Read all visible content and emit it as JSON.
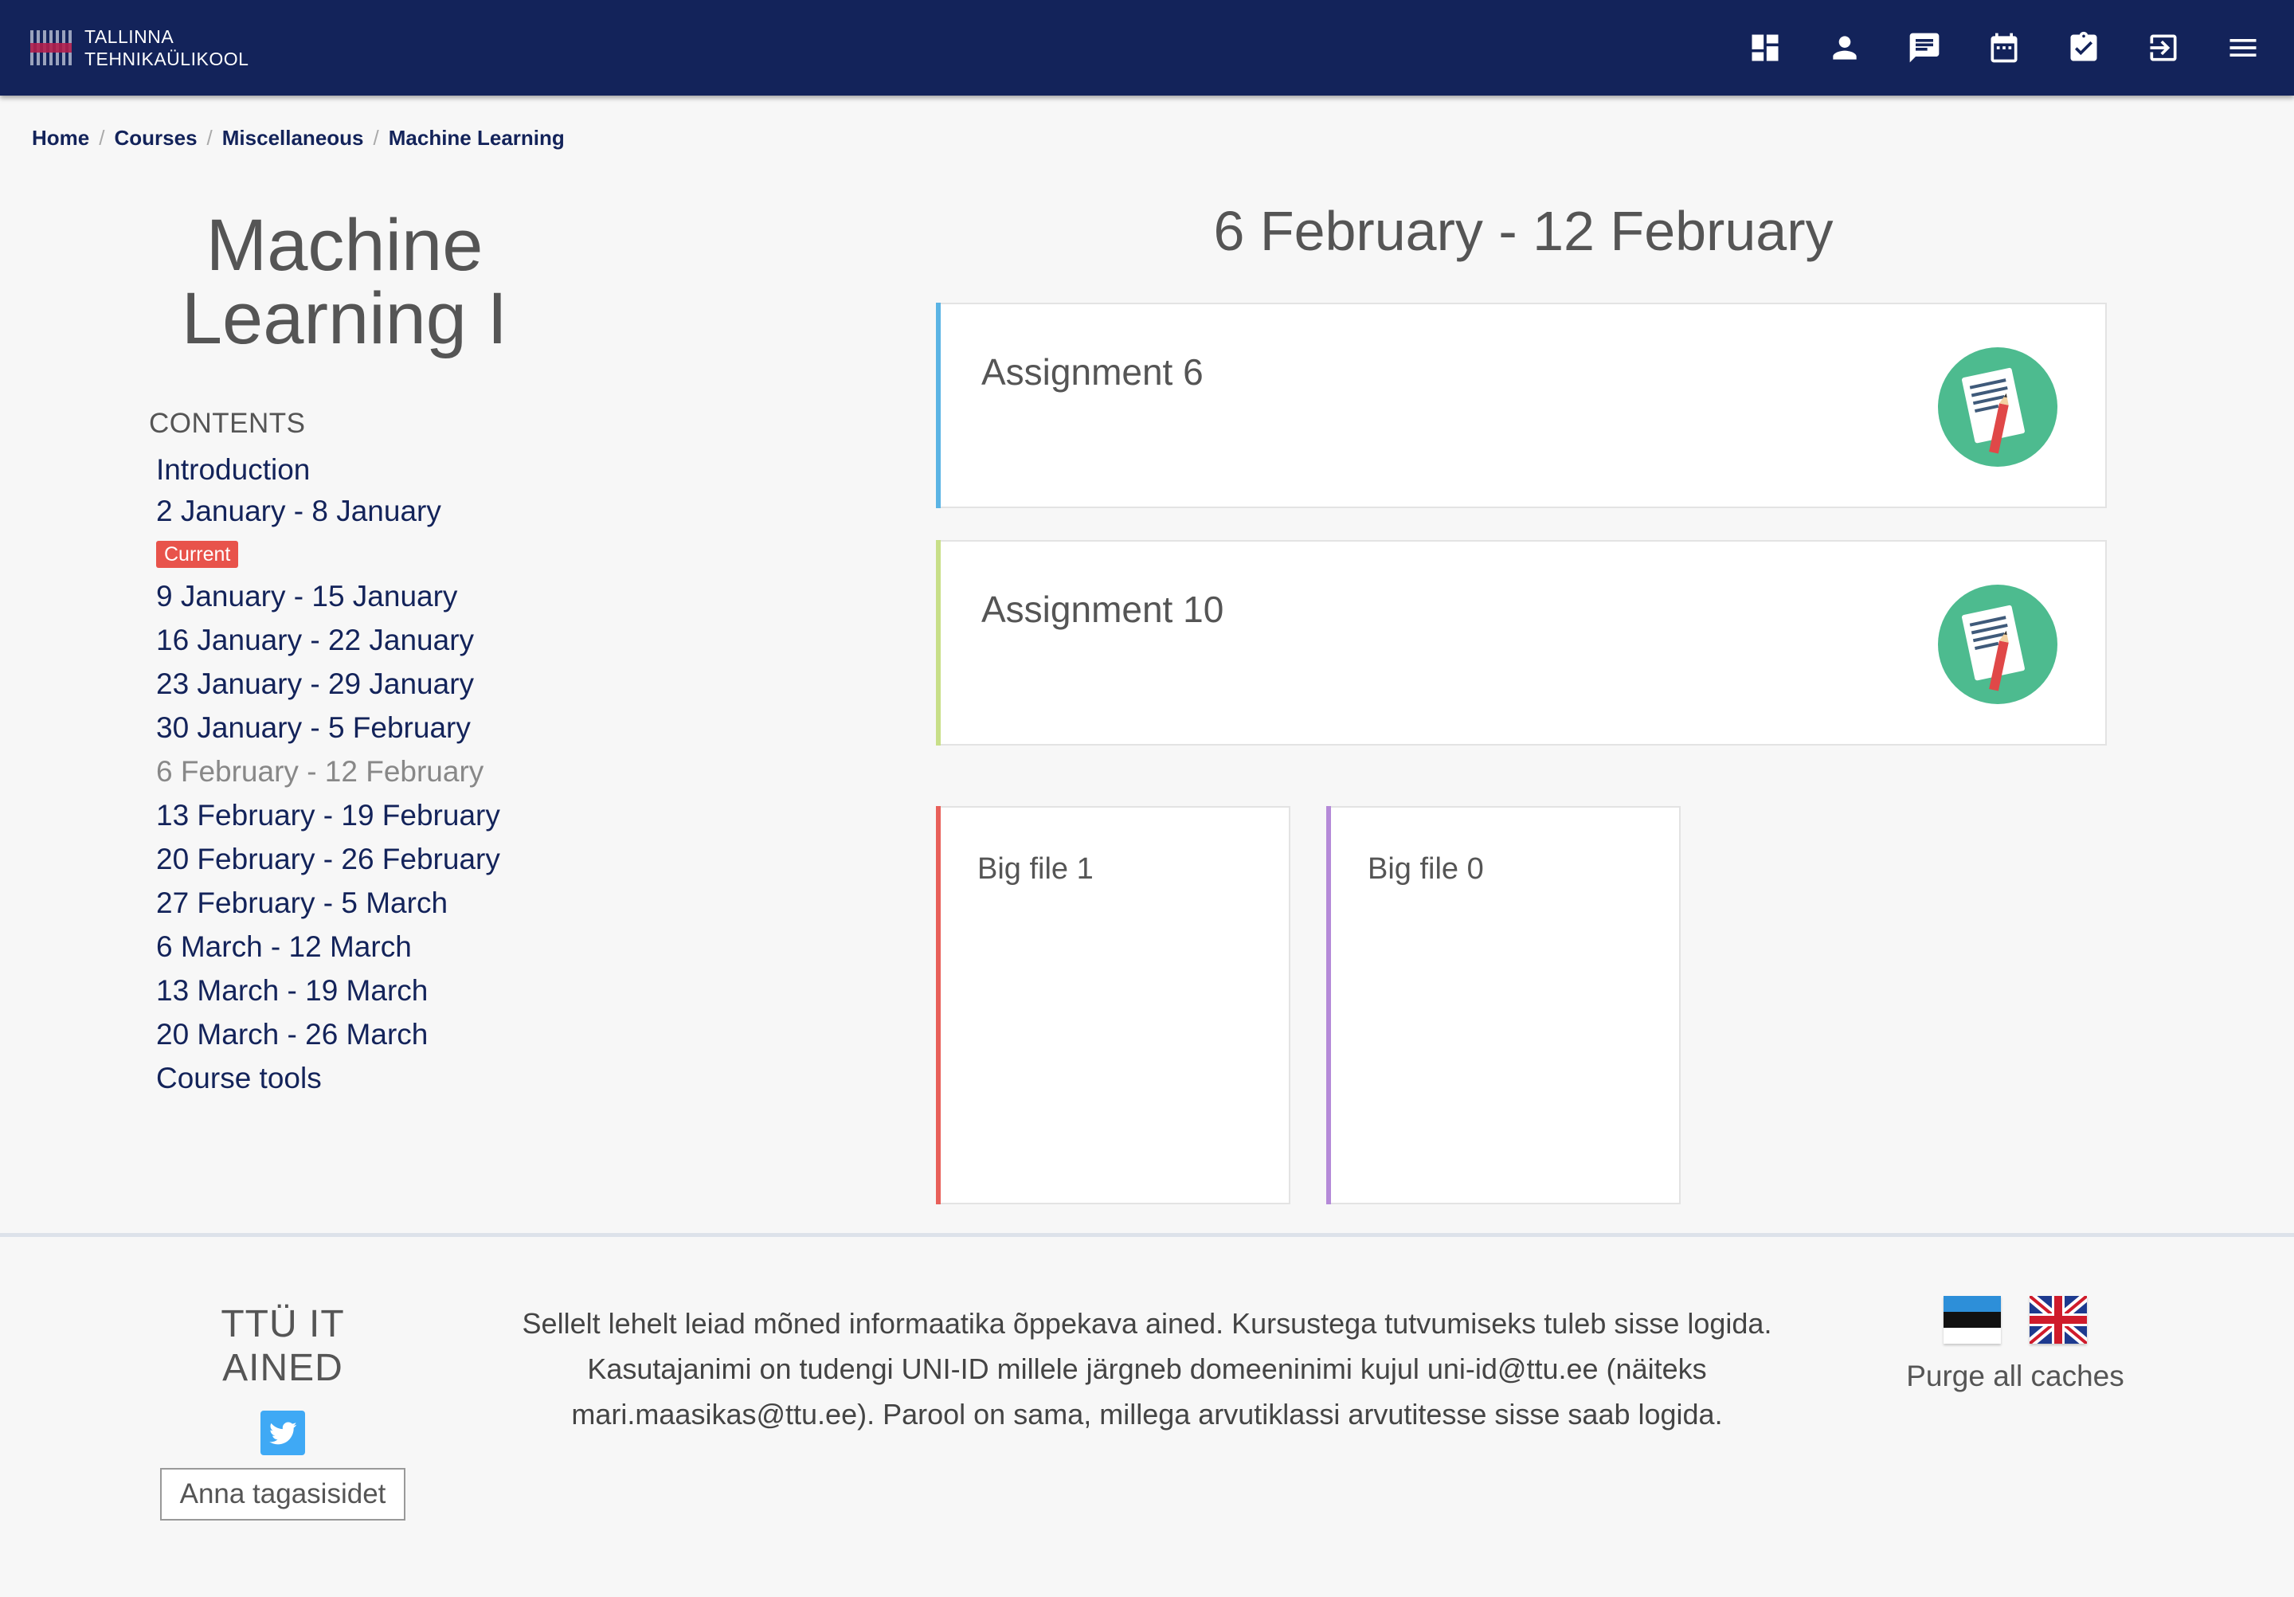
{
  "header": {
    "logo_line1": "TALLINNA",
    "logo_line2": "TEHNIKAÜLIKOOL",
    "nav_icons": [
      "dashboard-icon",
      "profile-icon",
      "messages-icon",
      "calendar-icon",
      "grades-icon",
      "login-icon",
      "menu-icon"
    ]
  },
  "breadcrumb": {
    "items": [
      "Home",
      "Courses",
      "Miscellaneous",
      "Machine Learning"
    ]
  },
  "course": {
    "title_line1": "Machine",
    "title_line2": "Learning I"
  },
  "contents": {
    "heading": "CONTENTS",
    "current_badge": "Current",
    "items": [
      "Introduction",
      "2 January - 8 January",
      "9 January - 15 January",
      "16 January - 22 January",
      "23 January - 29 January",
      "30 January - 5 February",
      "6 February - 12 February",
      "13 February - 19 February",
      "20 February - 26 February",
      "27 February - 5 March",
      "6 March - 12 March",
      "13 March - 19 March",
      "20 March - 26 March",
      "Course tools"
    ],
    "active_index": 6,
    "current_index": 1
  },
  "section": {
    "title": "6 February - 12 February",
    "activities": [
      {
        "name": "Assignment 6",
        "stripe_color": "#5bb4e4"
      },
      {
        "name": "Assignment 10",
        "stripe_color": "#c8df89"
      }
    ],
    "files": [
      {
        "name": "Big file 1",
        "stripe_color": "#e8605a"
      },
      {
        "name": "Big file 0",
        "stripe_color": "#b58ad8"
      }
    ]
  },
  "footer": {
    "brand": "TTÜ IT AINED",
    "feedback_button": "Anna tagasisidet",
    "text_line1": "Sellelt lehelt leiad mõned informaatika õppekava ained. Kursustega tutvumiseks tuleb sisse logida.",
    "text_line2": "Kasutajanimi on tudengi UNI-ID millele järgneb domeeninimi kujul uni-id@ttu.ee (näiteks",
    "text_line3": "mari.maasikas@ttu.ee). Parool on sama, millega arvutiklassi arvutitesse sisse saab logida.",
    "purge_link": "Purge all caches"
  },
  "colors": {
    "header_bg": "#13235a",
    "badge_bg": "#e8534b",
    "assignment_icon_bg": "#4dbb8f"
  }
}
